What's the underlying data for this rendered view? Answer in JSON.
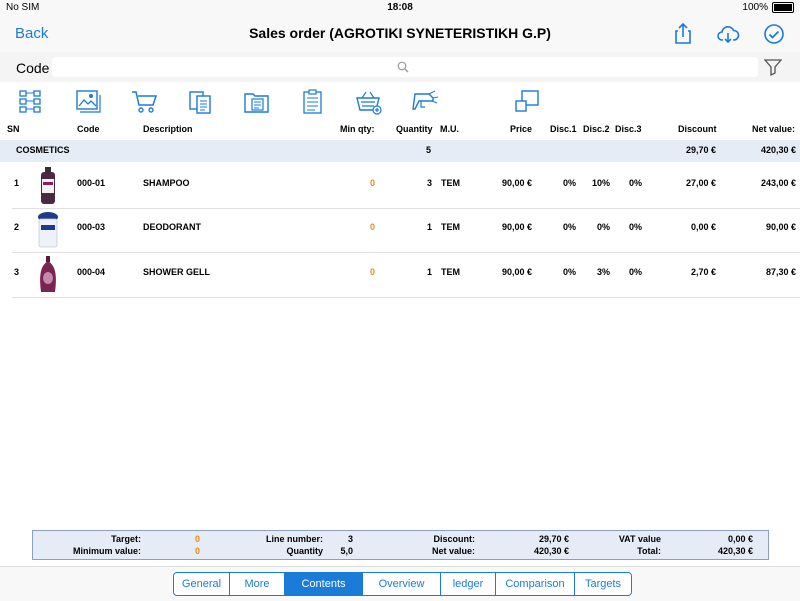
{
  "status": {
    "carrier": "No SIM",
    "time": "18:08",
    "battery": "100%"
  },
  "nav": {
    "back": "Back",
    "title": "Sales order (AGROTIKI SYNETERISTIKH G.P)"
  },
  "search": {
    "label": "Code",
    "placeholder": ""
  },
  "columns": {
    "sn": "SN",
    "code": "Code",
    "description": "Description",
    "min_qty": "Min qty:",
    "quantity": "Quantity",
    "mu": "M.U.",
    "price": "Price",
    "disc1": "Disc.1",
    "disc2": "Disc.2",
    "disc3": "Disc.3",
    "discount": "Discount",
    "net_value": "Net value:"
  },
  "group": {
    "name": "COSMETICS",
    "quantity": "5",
    "discount": "29,70 €",
    "net_value": "420,30 €"
  },
  "rows": [
    {
      "sn": "1",
      "code": "000-01",
      "description": "SHAMPOO",
      "min_qty": "0",
      "quantity": "3",
      "mu": "TEM",
      "price": "90,00 €",
      "disc1": "0%",
      "disc2": "10%",
      "disc3": "0%",
      "discount": "27,00 €",
      "net_value": "243,00 €"
    },
    {
      "sn": "2",
      "code": "000-03",
      "description": "DEODORANT",
      "min_qty": "0",
      "quantity": "1",
      "mu": "TEM",
      "price": "90,00 €",
      "disc1": "0%",
      "disc2": "0%",
      "disc3": "0%",
      "discount": "0,00 €",
      "net_value": "90,00 €"
    },
    {
      "sn": "3",
      "code": "000-04",
      "description": "SHOWER GELL",
      "min_qty": "0",
      "quantity": "1",
      "mu": "TEM",
      "price": "90,00 €",
      "disc1": "0%",
      "disc2": "3%",
      "disc3": "0%",
      "discount": "2,70 €",
      "net_value": "87,30 €"
    }
  ],
  "summary": {
    "target_label": "Target:",
    "target_value": "0",
    "min_value_label": "Minimum value:",
    "min_value_value": "0",
    "line_number_label": "Line number:",
    "line_number_value": "3",
    "quantity_label": "Quantity",
    "quantity_value": "5,0",
    "discount_label": "Discount:",
    "discount_value": "29,70 €",
    "net_value_label": "Net value:",
    "net_value_value": "420,30 €",
    "vat_label": "VAT value",
    "vat_value": "0,00 €",
    "total_label": "Total:",
    "total_value": "420,30 €"
  },
  "tabs": [
    {
      "label": "General",
      "active": false
    },
    {
      "label": "More",
      "active": false
    },
    {
      "label": "Contents",
      "active": true
    },
    {
      "label": "Overview",
      "active": false
    },
    {
      "label": "ledger",
      "active": false
    },
    {
      "label": "Comparison",
      "active": false
    },
    {
      "label": "Targets",
      "active": false
    }
  ],
  "colors": {
    "accent": "#1a7bd8",
    "highlight": "#f08a1c",
    "group_bg": "#e6ecf6"
  },
  "icons": [
    "grid-layout-icon",
    "image-gallery-icon",
    "cart-icon",
    "documents-icon",
    "folder-icon",
    "clipboard-icon",
    "basket-add-icon",
    "barcode-scanner-icon",
    "resize-icon"
  ]
}
